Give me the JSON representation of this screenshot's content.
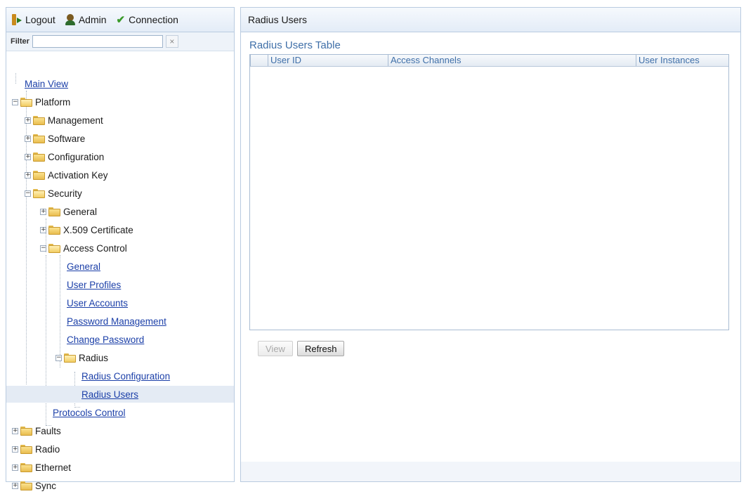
{
  "topbar": {
    "logout_label": "Logout",
    "admin_label": "Admin",
    "connection_label": "Connection"
  },
  "filter": {
    "label": "Filter",
    "value": "",
    "clear": "×"
  },
  "tree": {
    "main_view": "Main View",
    "platform": "Platform",
    "management": "Management",
    "software": "Software",
    "configuration": "Configuration",
    "activation_key": "Activation Key",
    "security": "Security",
    "general_folder": "General",
    "x509": "X.509 Certificate",
    "access_control": "Access Control",
    "ac_general": "General",
    "user_profiles": "User Profiles",
    "user_accounts": "User Accounts",
    "password_management": "Password Management",
    "change_password": "Change Password",
    "radius": "Radius",
    "radius_configuration": "Radius Configuration",
    "radius_users": "Radius Users",
    "protocols_control": "Protocols Control",
    "faults": "Faults",
    "radio": "Radio",
    "ethernet": "Ethernet",
    "sync": "Sync",
    "expand_sign": "+",
    "collapse_sign": "−"
  },
  "main": {
    "header": "Radius Users",
    "table_title": "Radius Users Table",
    "columns": [
      "User ID",
      "Access Channels",
      "User Instances"
    ],
    "rows": [],
    "view_label": "View",
    "refresh_label": "Refresh"
  }
}
